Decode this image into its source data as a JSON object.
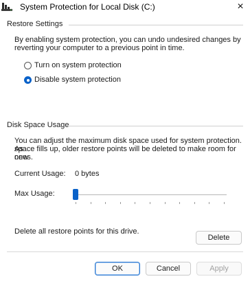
{
  "window": {
    "title": "System Protection for Local Disk (C:)",
    "close_glyph": "×"
  },
  "restore_settings": {
    "group_label": "Restore Settings",
    "description_line1": "By enabling system protection, you can undo undesired changes by",
    "description_line2": "reverting your computer to a previous point in time.",
    "options": [
      {
        "label": "Turn on system protection",
        "selected": false
      },
      {
        "label": "Disable system protection",
        "selected": true
      }
    ]
  },
  "disk_space": {
    "group_label": "Disk Space Usage",
    "description_line1": "You can adjust the maximum disk space used for system protection. As",
    "description_line2": "space fills up, older restore points will be deleted to make room for new",
    "description_line3": "ones.",
    "current_usage_label": "Current Usage:",
    "current_usage_value": "0 bytes",
    "max_usage_label": "Max Usage:",
    "max_usage_value": 0
  },
  "delete_section": {
    "text": "Delete all restore points for this drive.",
    "button_label": "Delete"
  },
  "buttons": {
    "ok": "OK",
    "cancel": "Cancel",
    "apply": "Apply"
  },
  "colors": {
    "accent": "#0a62c9",
    "disabled_text": "#a0a0a0"
  }
}
